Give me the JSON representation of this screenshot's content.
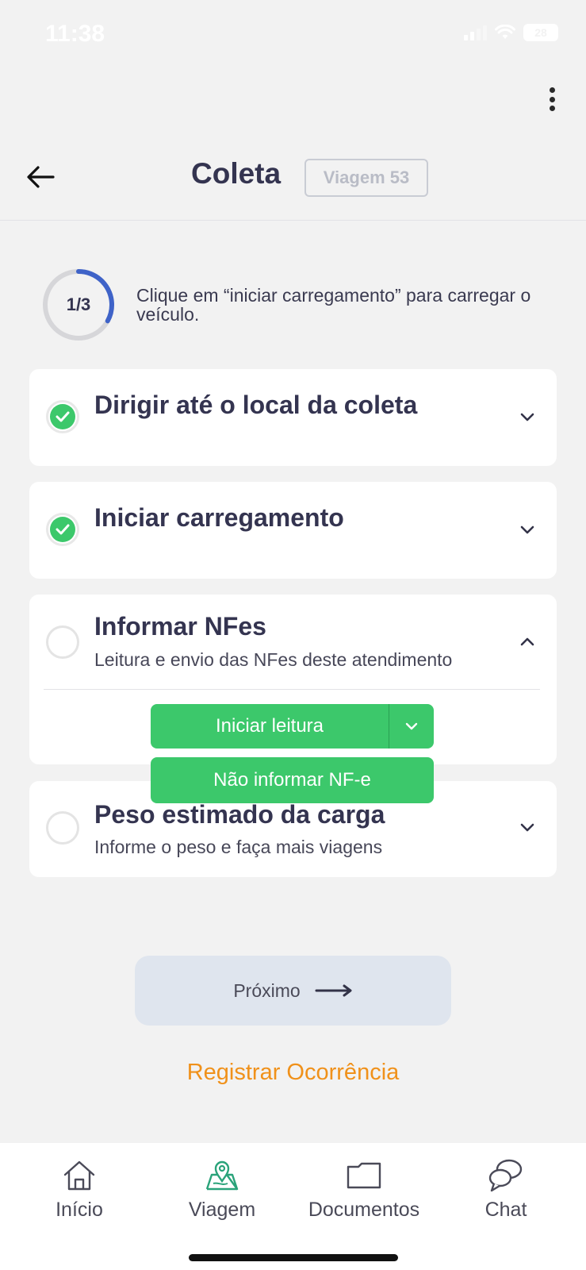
{
  "status_bar": {
    "time": "11:38",
    "battery": "28"
  },
  "header": {
    "title": "Coleta",
    "trip_badge": "Viagem 53"
  },
  "progress": {
    "label": "1/3",
    "fraction": 0.33,
    "instruction": "Clique em “iniciar carregamento” para carregar o veículo."
  },
  "steps": [
    {
      "title": "Dirigir até o local da coleta",
      "subtitle": "",
      "done": true
    },
    {
      "title": "Iniciar carregamento",
      "subtitle": "",
      "done": true
    },
    {
      "title": "Informar NFes",
      "subtitle": "Leitura e envio das NFes deste atendimento",
      "done": false,
      "expanded": true
    },
    {
      "title": "Peso estimado da carga",
      "subtitle": "Informe o peso e faça mais viagens",
      "done": false
    }
  ],
  "nfe_actions": {
    "primary_label": "Iniciar leitura",
    "dropdown_option": "Não informar NF-e"
  },
  "next_button": {
    "label": "Próximo"
  },
  "occurrence_link": {
    "label": "Registrar Ocorrência"
  },
  "tabbar": {
    "items": [
      {
        "label": "Início",
        "icon": "home-icon"
      },
      {
        "label": "Viagem",
        "icon": "map-pin-icon",
        "active": true
      },
      {
        "label": "Documentos",
        "icon": "folder-icon"
      },
      {
        "label": "Chat",
        "icon": "chat-icon"
      }
    ]
  },
  "colors": {
    "accent_green": "#3cc86b",
    "progress_blue": "#3f63c8",
    "link_orange": "#f0911a",
    "map_active": "#2aa37a"
  }
}
